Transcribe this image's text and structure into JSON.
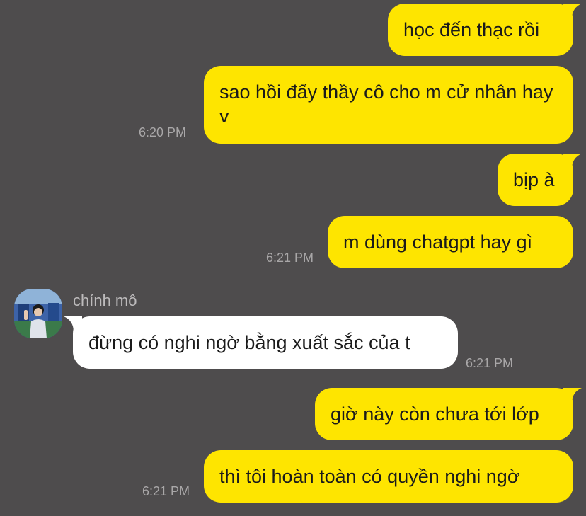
{
  "conversation": {
    "messages": [
      {
        "text": "học đến thạc rồi",
        "side": "outgoing"
      },
      {
        "text": "sao hồi đấy thầy cô cho m cử nhân hay v",
        "side": "outgoing",
        "time": "6:20 PM"
      },
      {
        "text": "bịp à",
        "side": "outgoing"
      },
      {
        "text": "m dùng chatgpt hay gì",
        "side": "outgoing",
        "time": "6:21 PM"
      },
      {
        "sender": "chính mô",
        "text": "đừng có nghi ngờ bằng xuất sắc của t",
        "side": "incoming",
        "time": "6:21 PM"
      },
      {
        "text": "giờ này còn chưa tới lớp",
        "side": "outgoing"
      },
      {
        "text": "thì tôi hoàn toàn có quyền nghi ngờ",
        "side": "outgoing",
        "time": "6:21 PM"
      }
    ]
  },
  "colors": {
    "background": "#4e4c4d",
    "outgoing_bubble": "#fee500",
    "incoming_bubble": "#ffffff",
    "message_text": "#1b1b1b",
    "timestamp_text": "#a9a7a8",
    "sender_name_text": "#bdbbbc"
  }
}
